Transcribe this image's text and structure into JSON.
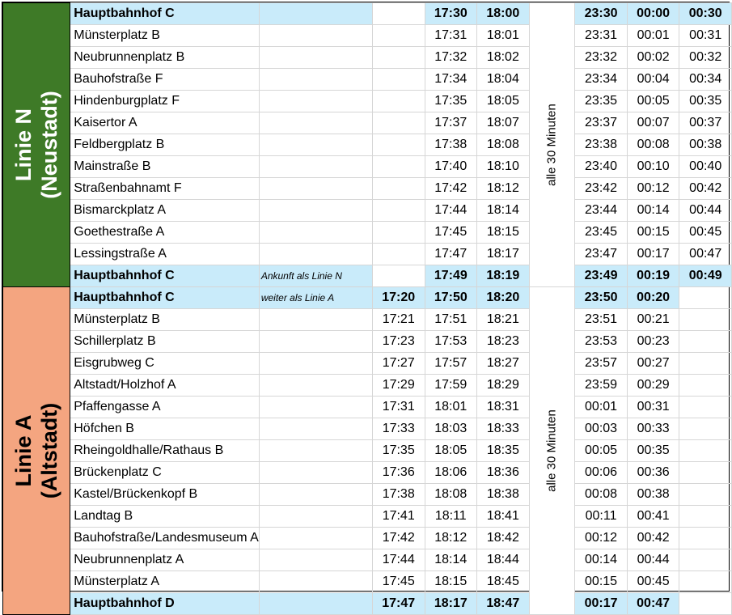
{
  "line_n": {
    "title": "Linie N",
    "subtitle": "(Neustadt)",
    "frequency": "alle 30 Minuten",
    "rows": [
      {
        "stop": "Hauptbahnhof C",
        "note": "",
        "highlight": true,
        "d1": "",
        "d2": "17:30",
        "d3": "18:00",
        "l1": "23:30",
        "l2": "00:00",
        "l3": "00:30"
      },
      {
        "stop": "Münsterplatz B",
        "note": "",
        "highlight": false,
        "d1": "",
        "d2": "17:31",
        "d3": "18:01",
        "l1": "23:31",
        "l2": "00:01",
        "l3": "00:31"
      },
      {
        "stop": "Neubrunnenplatz B",
        "note": "",
        "highlight": false,
        "d1": "",
        "d2": "17:32",
        "d3": "18:02",
        "l1": "23:32",
        "l2": "00:02",
        "l3": "00:32"
      },
      {
        "stop": "Bauhofstraße F",
        "note": "",
        "highlight": false,
        "d1": "",
        "d2": "17:34",
        "d3": "18:04",
        "l1": "23:34",
        "l2": "00:04",
        "l3": "00:34"
      },
      {
        "stop": "Hindenburgplatz F",
        "note": "",
        "highlight": false,
        "d1": "",
        "d2": "17:35",
        "d3": "18:05",
        "l1": "23:35",
        "l2": "00:05",
        "l3": "00:35"
      },
      {
        "stop": "Kaisertor A",
        "note": "",
        "highlight": false,
        "d1": "",
        "d2": "17:37",
        "d3": "18:07",
        "l1": "23:37",
        "l2": "00:07",
        "l3": "00:37"
      },
      {
        "stop": "Feldbergplatz B",
        "note": "",
        "highlight": false,
        "d1": "",
        "d2": "17:38",
        "d3": "18:08",
        "l1": "23:38",
        "l2": "00:08",
        "l3": "00:38"
      },
      {
        "stop": "Mainstraße B",
        "note": "",
        "highlight": false,
        "d1": "",
        "d2": "17:40",
        "d3": "18:10",
        "l1": "23:40",
        "l2": "00:10",
        "l3": "00:40"
      },
      {
        "stop": "Straßenbahnamt F",
        "note": "",
        "highlight": false,
        "d1": "",
        "d2": "17:42",
        "d3": "18:12",
        "l1": "23:42",
        "l2": "00:12",
        "l3": "00:42"
      },
      {
        "stop": "Bismarckplatz A",
        "note": "",
        "highlight": false,
        "d1": "",
        "d2": "17:44",
        "d3": "18:14",
        "l1": "23:44",
        "l2": "00:14",
        "l3": "00:44"
      },
      {
        "stop": "Goethestraße A",
        "note": "",
        "highlight": false,
        "d1": "",
        "d2": "17:45",
        "d3": "18:15",
        "l1": "23:45",
        "l2": "00:15",
        "l3": "00:45"
      },
      {
        "stop": "Lessingstraße A",
        "note": "",
        "highlight": false,
        "d1": "",
        "d2": "17:47",
        "d3": "18:17",
        "l1": "23:47",
        "l2": "00:17",
        "l3": "00:47"
      },
      {
        "stop": "Hauptbahnhof C",
        "note": "Ankunft als Linie N",
        "highlight": true,
        "d1": "",
        "d2": "17:49",
        "d3": "18:19",
        "l1": "23:49",
        "l2": "00:19",
        "l3": "00:49"
      }
    ]
  },
  "line_a": {
    "title": "Linie A",
    "subtitle": "(Altstadt)",
    "frequency": "alle 30 Minuten",
    "rows": [
      {
        "stop": "Hauptbahnhof C",
        "note": "weiter als Linie A",
        "highlight": true,
        "d1": "17:20",
        "d2": "17:50",
        "d3": "18:20",
        "l1": "23:50",
        "l2": "00:20",
        "l3": ""
      },
      {
        "stop": "Münsterplatz B",
        "note": "",
        "highlight": false,
        "d1": "17:21",
        "d2": "17:51",
        "d3": "18:21",
        "l1": "23:51",
        "l2": "00:21",
        "l3": ""
      },
      {
        "stop": "Schillerplatz B",
        "note": "",
        "highlight": false,
        "d1": "17:23",
        "d2": "17:53",
        "d3": "18:23",
        "l1": "23:53",
        "l2": "00:23",
        "l3": ""
      },
      {
        "stop": "Eisgrubweg C",
        "note": "",
        "highlight": false,
        "d1": "17:27",
        "d2": "17:57",
        "d3": "18:27",
        "l1": "23:57",
        "l2": "00:27",
        "l3": ""
      },
      {
        "stop": "Altstadt/Holzhof A",
        "note": "",
        "highlight": false,
        "d1": "17:29",
        "d2": "17:59",
        "d3": "18:29",
        "l1": "23:59",
        "l2": "00:29",
        "l3": ""
      },
      {
        "stop": "Pfaffengasse A",
        "note": "",
        "highlight": false,
        "d1": "17:31",
        "d2": "18:01",
        "d3": "18:31",
        "l1": "00:01",
        "l2": "00:31",
        "l3": ""
      },
      {
        "stop": "Höfchen B",
        "note": "",
        "highlight": false,
        "d1": "17:33",
        "d2": "18:03",
        "d3": "18:33",
        "l1": "00:03",
        "l2": "00:33",
        "l3": ""
      },
      {
        "stop": "Rheingoldhalle/Rathaus B",
        "note": "",
        "highlight": false,
        "d1": "17:35",
        "d2": "18:05",
        "d3": "18:35",
        "l1": "00:05",
        "l2": "00:35",
        "l3": ""
      },
      {
        "stop": "Brückenplatz C",
        "note": "",
        "highlight": false,
        "d1": "17:36",
        "d2": "18:06",
        "d3": "18:36",
        "l1": "00:06",
        "l2": "00:36",
        "l3": ""
      },
      {
        "stop": "Kastel/Brückenkopf B",
        "note": "",
        "highlight": false,
        "d1": "17:38",
        "d2": "18:08",
        "d3": "18:38",
        "l1": "00:08",
        "l2": "00:38",
        "l3": ""
      },
      {
        "stop": "Landtag B",
        "note": "",
        "highlight": false,
        "d1": "17:41",
        "d2": "18:11",
        "d3": "18:41",
        "l1": "00:11",
        "l2": "00:41",
        "l3": ""
      },
      {
        "stop": "Bauhofstraße/Landesmuseum A",
        "note": "",
        "highlight": false,
        "d1": "17:42",
        "d2": "18:12",
        "d3": "18:42",
        "l1": "00:12",
        "l2": "00:42",
        "l3": ""
      },
      {
        "stop": "Neubrunnenplatz A",
        "note": "",
        "highlight": false,
        "d1": "17:44",
        "d2": "18:14",
        "d3": "18:44",
        "l1": "00:14",
        "l2": "00:44",
        "l3": ""
      },
      {
        "stop": "Münsterplatz A",
        "note": "",
        "highlight": false,
        "d1": "17:45",
        "d2": "18:15",
        "d3": "18:45",
        "l1": "00:15",
        "l2": "00:45",
        "l3": ""
      },
      {
        "stop": "Hauptbahnhof D",
        "note": "",
        "highlight": true,
        "d1": "17:47",
        "d2": "18:17",
        "d3": "18:47",
        "l1": "00:17",
        "l2": "00:47",
        "l3": ""
      }
    ]
  },
  "colors": {
    "line_n_bg": "#3e7a27",
    "line_a_bg": "#f4a580",
    "highlight_row": "#c9ebfa"
  }
}
